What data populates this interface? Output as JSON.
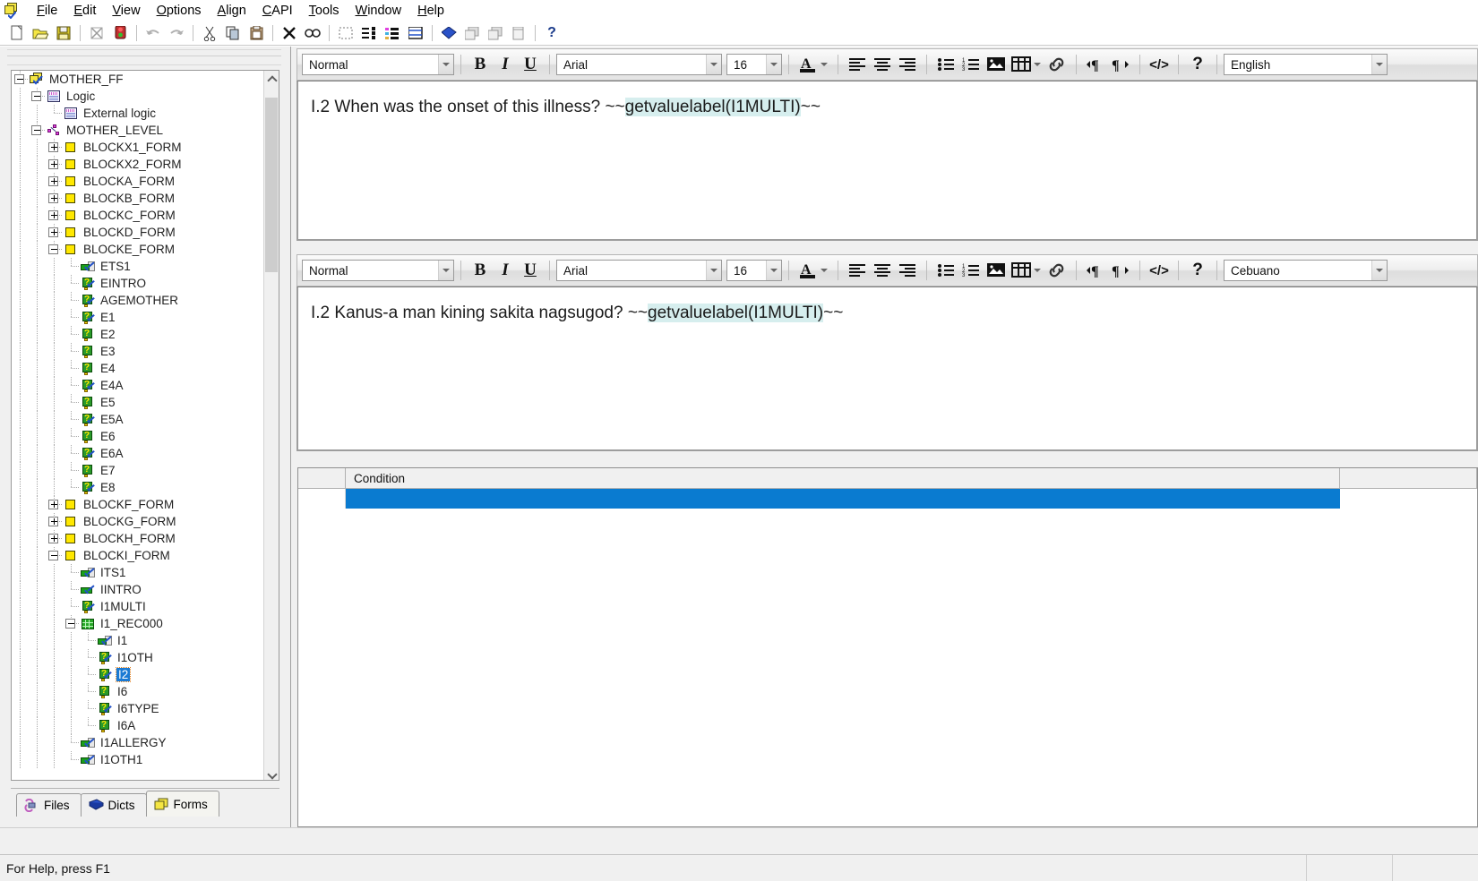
{
  "app": {
    "icon": "cspro-forms-icon",
    "status_text": "For Help, press F1"
  },
  "menubar": {
    "items": [
      {
        "label": "File",
        "accel": "F"
      },
      {
        "label": "Edit",
        "accel": "E"
      },
      {
        "label": "View",
        "accel": "V"
      },
      {
        "label": "Options",
        "accel": "O"
      },
      {
        "label": "Align",
        "accel": "A"
      },
      {
        "label": "CAPI",
        "accel": "C"
      },
      {
        "label": "Tools",
        "accel": "T"
      },
      {
        "label": "Window",
        "accel": "W"
      },
      {
        "label": "Help",
        "accel": "H"
      }
    ]
  },
  "toolbar": {
    "buttons": [
      {
        "name": "new-icon",
        "glyph": "⬜"
      },
      {
        "name": "open-icon",
        "glyph": "📂"
      },
      {
        "name": "save-icon",
        "glyph": "💾"
      },
      {
        "name": "filter-icon",
        "glyph": "⧖"
      },
      {
        "name": "traffic-light-icon",
        "glyph": "🚦"
      },
      {
        "name": "undo-icon",
        "glyph": "↶"
      },
      {
        "name": "redo-icon",
        "glyph": "↷"
      },
      {
        "name": "cut-icon",
        "glyph": "✂"
      },
      {
        "name": "copy-icon",
        "glyph": "⧉"
      },
      {
        "name": "paste-icon",
        "glyph": "📋"
      },
      {
        "name": "delete-icon",
        "glyph": "✕"
      },
      {
        "name": "find-icon",
        "glyph": "🔭"
      },
      {
        "name": "select-region-icon",
        "glyph": "⬚"
      },
      {
        "name": "order-items-icon",
        "glyph": "≣"
      },
      {
        "name": "colored-list-icon",
        "glyph": "≡"
      },
      {
        "name": "form-view-icon",
        "glyph": "▤"
      },
      {
        "name": "dictionary-icon",
        "glyph": "◆"
      },
      {
        "name": "tile-windows-icon",
        "glyph": "⧉"
      },
      {
        "name": "cascade-windows-icon",
        "glyph": "⧉"
      },
      {
        "name": "single-window-icon",
        "glyph": "▧"
      },
      {
        "name": "help-icon",
        "glyph": "?"
      }
    ]
  },
  "sidebar": {
    "tabs": [
      {
        "label": "Files",
        "icon": "files-icon",
        "active": false
      },
      {
        "label": "Dicts",
        "icon": "dictionary-book-icon",
        "active": false
      },
      {
        "label": "Forms",
        "icon": "forms-icon",
        "active": true
      }
    ],
    "tree": [
      {
        "label": "MOTHER_FF",
        "depth": 0,
        "icon": "forms-file-icon",
        "toggle": "minus",
        "selected": false
      },
      {
        "label": "Logic",
        "depth": 1,
        "icon": "logic-icon",
        "toggle": "minus",
        "selected": false
      },
      {
        "label": "External logic",
        "depth": 2,
        "icon": "logic-icon",
        "toggle": "none",
        "selected": false
      },
      {
        "label": "MOTHER_LEVEL",
        "depth": 1,
        "icon": "level-icon",
        "toggle": "minus",
        "selected": false
      },
      {
        "label": "BLOCKX1_FORM",
        "depth": 2,
        "icon": "form-icon",
        "toggle": "plus",
        "selected": false
      },
      {
        "label": "BLOCKX2_FORM",
        "depth": 2,
        "icon": "form-icon",
        "toggle": "plus",
        "selected": false
      },
      {
        "label": "BLOCKA_FORM",
        "depth": 2,
        "icon": "form-icon",
        "toggle": "plus",
        "selected": false
      },
      {
        "label": "BLOCKB_FORM",
        "depth": 2,
        "icon": "form-icon",
        "toggle": "plus",
        "selected": false
      },
      {
        "label": "BLOCKC_FORM",
        "depth": 2,
        "icon": "form-icon",
        "toggle": "plus",
        "selected": false
      },
      {
        "label": "BLOCKD_FORM",
        "depth": 2,
        "icon": "form-icon",
        "toggle": "plus",
        "selected": false
      },
      {
        "label": "BLOCKE_FORM",
        "depth": 2,
        "icon": "form-icon",
        "toggle": "minus",
        "selected": false
      },
      {
        "label": "ETS1",
        "depth": 3,
        "icon": "text-field-icon",
        "toggle": "none",
        "selected": false
      },
      {
        "label": "EINTRO",
        "depth": 3,
        "icon": "question-check-icon",
        "toggle": "none",
        "selected": false
      },
      {
        "label": "AGEMOTHER",
        "depth": 3,
        "icon": "question-check-icon",
        "toggle": "none",
        "selected": false
      },
      {
        "label": "E1",
        "depth": 3,
        "icon": "question-check-icon",
        "toggle": "none",
        "selected": false
      },
      {
        "label": "E2",
        "depth": 3,
        "icon": "question-icon",
        "toggle": "none",
        "selected": false
      },
      {
        "label": "E3",
        "depth": 3,
        "icon": "question-icon",
        "toggle": "none",
        "selected": false
      },
      {
        "label": "E4",
        "depth": 3,
        "icon": "question-icon",
        "toggle": "none",
        "selected": false
      },
      {
        "label": "E4A",
        "depth": 3,
        "icon": "question-check-icon",
        "toggle": "none",
        "selected": false
      },
      {
        "label": "E5",
        "depth": 3,
        "icon": "question-icon",
        "toggle": "none",
        "selected": false
      },
      {
        "label": "E5A",
        "depth": 3,
        "icon": "question-check-icon",
        "toggle": "none",
        "selected": false
      },
      {
        "label": "E6",
        "depth": 3,
        "icon": "question-icon",
        "toggle": "none",
        "selected": false
      },
      {
        "label": "E6A",
        "depth": 3,
        "icon": "question-check-icon",
        "toggle": "none",
        "selected": false
      },
      {
        "label": "E7",
        "depth": 3,
        "icon": "question-icon",
        "toggle": "none",
        "selected": false
      },
      {
        "label": "E8",
        "depth": 3,
        "icon": "question-check-icon",
        "toggle": "none",
        "selected": false
      },
      {
        "label": "BLOCKF_FORM",
        "depth": 2,
        "icon": "form-icon",
        "toggle": "plus",
        "selected": false
      },
      {
        "label": "BLOCKG_FORM",
        "depth": 2,
        "icon": "form-icon",
        "toggle": "plus",
        "selected": false
      },
      {
        "label": "BLOCKH_FORM",
        "depth": 2,
        "icon": "form-icon",
        "toggle": "plus",
        "selected": false
      },
      {
        "label": "BLOCKI_FORM",
        "depth": 2,
        "icon": "form-icon",
        "toggle": "minus",
        "selected": false
      },
      {
        "label": "ITS1",
        "depth": 3,
        "icon": "text-field-icon",
        "toggle": "none",
        "selected": false
      },
      {
        "label": "IINTRO",
        "depth": 3,
        "icon": "text-check-icon",
        "toggle": "none",
        "selected": false
      },
      {
        "label": "I1MULTI",
        "depth": 3,
        "icon": "question-check-icon",
        "toggle": "none",
        "selected": false
      },
      {
        "label": "I1_REC000",
        "depth": 3,
        "icon": "roster-icon",
        "toggle": "minus",
        "selected": false
      },
      {
        "label": "I1",
        "depth": 4,
        "icon": "text-field-icon",
        "toggle": "none",
        "selected": false
      },
      {
        "label": "I1OTH",
        "depth": 4,
        "icon": "question-check-icon",
        "toggle": "none",
        "selected": false
      },
      {
        "label": "I2",
        "depth": 4,
        "icon": "question-check-icon",
        "toggle": "none",
        "selected": true
      },
      {
        "label": "I6",
        "depth": 4,
        "icon": "question-icon",
        "toggle": "none",
        "selected": false
      },
      {
        "label": "I6TYPE",
        "depth": 4,
        "icon": "question-check-icon",
        "toggle": "none",
        "selected": false
      },
      {
        "label": "I6A",
        "depth": 4,
        "icon": "question-icon",
        "toggle": "none",
        "selected": false
      },
      {
        "label": "I1ALLERGY",
        "depth": 3,
        "icon": "text-field-icon",
        "toggle": "none",
        "selected": false
      },
      {
        "label": "I1OTH1",
        "depth": 3,
        "icon": "text-field-icon",
        "toggle": "none",
        "selected": false
      }
    ]
  },
  "editors": [
    {
      "id": "english",
      "style_value": "Normal",
      "font_value": "Arial",
      "size_value": "16",
      "language_value": "English",
      "bold_label": "B",
      "italic_label": "I",
      "underline_label": "U",
      "font_color_label": "A",
      "help_label": "?",
      "text_prefix": "I.2 When was the onset of this illness? ~~",
      "text_highlight": "getvaluelabel(I1MULTI)",
      "text_suffix": "~~"
    },
    {
      "id": "cebuano",
      "style_value": "Normal",
      "font_value": "Arial",
      "size_value": "16",
      "language_value": "Cebuano",
      "bold_label": "B",
      "italic_label": "I",
      "underline_label": "U",
      "font_color_label": "A",
      "help_label": "?",
      "text_prefix": "I.2 Kanus-a man kining sakita nagsugod? ~~",
      "text_highlight": "getvaluelabel(I1MULTI)",
      "text_suffix": "~~"
    }
  ],
  "editor_toolbar_icons": [
    {
      "name": "align-left-icon",
      "glyph": "≡"
    },
    {
      "name": "align-center-icon",
      "glyph": "≡"
    },
    {
      "name": "align-right-icon",
      "glyph": "≡"
    },
    {
      "name": "bullet-list-icon",
      "glyph": "☰"
    },
    {
      "name": "numbered-list-icon",
      "glyph": "☰"
    },
    {
      "name": "insert-image-icon",
      "glyph": "🖼"
    },
    {
      "name": "insert-table-icon",
      "glyph": "▦"
    },
    {
      "name": "insert-link-icon",
      "glyph": "🔗"
    },
    {
      "name": "ltr-paragraph-icon",
      "glyph": "¶"
    },
    {
      "name": "rtl-paragraph-icon",
      "glyph": "¶"
    },
    {
      "name": "source-code-icon",
      "glyph": "</>"
    }
  ],
  "condition_grid": {
    "columns": [
      "Condition"
    ],
    "rows": [
      {
        "condition": ""
      }
    ]
  },
  "colors": {
    "selection_blue": "#0a7bd0",
    "highlight_cyan": "#d6eeee",
    "form_yellow": "#ffe800",
    "roster_green": "#27a727"
  }
}
